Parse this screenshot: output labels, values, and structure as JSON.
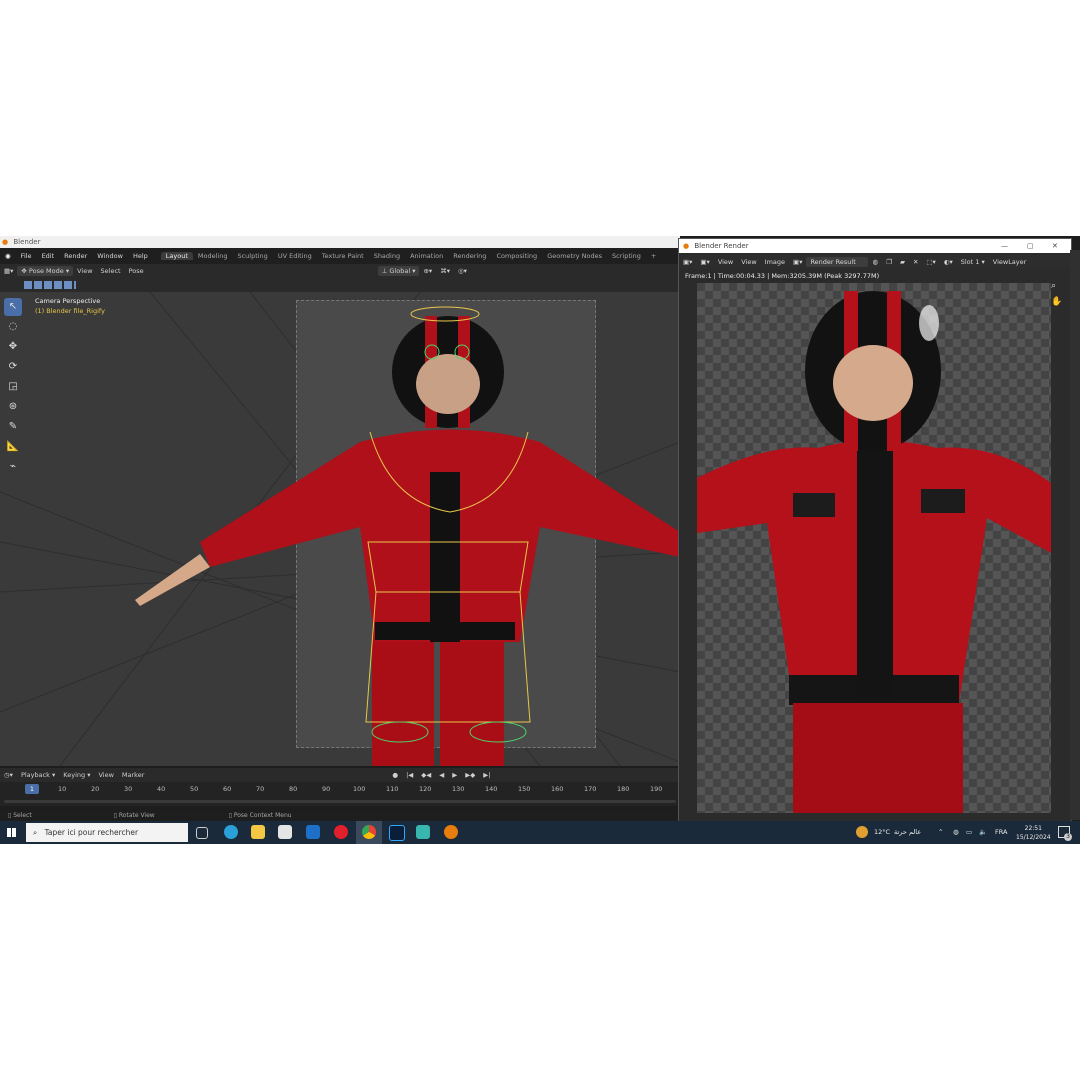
{
  "app": {
    "title": "Blender"
  },
  "menu": [
    "File",
    "Edit",
    "Render",
    "Window",
    "Help"
  ],
  "workspaces": [
    "Layout",
    "Modeling",
    "Sculpting",
    "UV Editing",
    "Texture Paint",
    "Shading",
    "Animation",
    "Rendering",
    "Compositing",
    "Geometry Nodes",
    "Scripting"
  ],
  "workspace_add": "+",
  "header": {
    "mode": "Pose Mode",
    "view": "View",
    "select": "Select",
    "pose": "Pose",
    "orientation": "Global"
  },
  "viewport": {
    "label": "Camera Perspective",
    "sublabel": "(1) Blender file_Rigify"
  },
  "timeline": {
    "playback": "Playback",
    "keying": "Keying",
    "view": "View",
    "marker": "Marker",
    "current_frame": "1",
    "ticks": [
      "10",
      "20",
      "30",
      "40",
      "50",
      "60",
      "70",
      "80",
      "90",
      "100",
      "110",
      "120",
      "130",
      "140",
      "150",
      "160",
      "170",
      "180",
      "190"
    ]
  },
  "status": {
    "select": "Select",
    "rotate": "Rotate View",
    "context": "Pose Context Menu"
  },
  "render_window": {
    "title": "Blender Render",
    "view": "View",
    "view2": "View",
    "image": "Image",
    "result": "Render Result",
    "slot": "Slot 1",
    "layer": "ViewLayer",
    "info": "Frame:1 | Time:00:04.33 | Mem:3205.39M (Peak 3297.77M)"
  },
  "taskbar": {
    "search_placeholder": "Taper ici pour rechercher",
    "weather": "12°C",
    "weather_text": "عالم حرتة",
    "lang": "FRA",
    "time": "22:51",
    "date": "15/12/2024",
    "notif_count": "3"
  },
  "colors": {
    "accent": "#4a6fa8",
    "jacket": "#b0101a",
    "rig": "#e8c64a"
  }
}
